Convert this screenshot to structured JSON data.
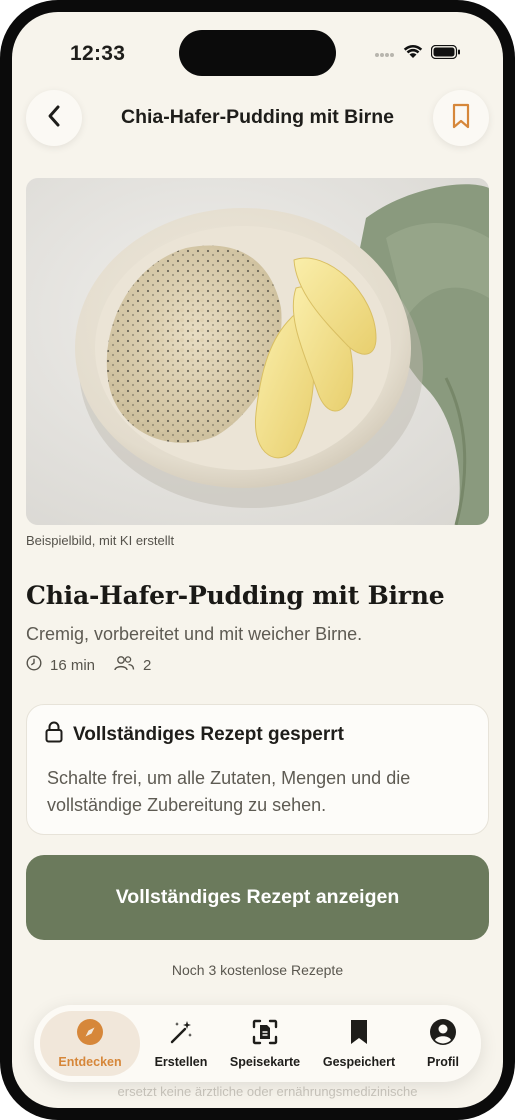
{
  "status_bar": {
    "time": "12:33"
  },
  "header": {
    "title": "Chia-Hafer-Pudding mit Birne"
  },
  "hero": {
    "caption": "Beispielbild, mit KI erstellt"
  },
  "recipe": {
    "title": "Chia-Hafer-Pudding mit Birne",
    "subtitle": "Cremig, vorbereitet und mit weicher Birne.",
    "time": "16 min",
    "servings": "2"
  },
  "locked": {
    "title": "Vollständiges Rezept gesperrt",
    "text": "Schalte frei, um alle Zutaten, Mengen und die vollständige Zubereitung zu sehen."
  },
  "cta": {
    "label": "Vollständiges Rezept anzeigen"
  },
  "free_note": "Noch 3 kostenlose Rezepte",
  "under_text": "ersetzt keine ärztliche oder ernährungsmedizinische",
  "tabs": [
    {
      "label": "Entdecken",
      "icon": "compass-icon",
      "active": true
    },
    {
      "label": "Erstellen",
      "icon": "magic-wand-icon",
      "active": false
    },
    {
      "label": "Speisekarte",
      "icon": "scan-menu-icon",
      "active": false
    },
    {
      "label": "Gespeichert",
      "icon": "bookmark-icon",
      "active": false
    },
    {
      "label": "Profil",
      "icon": "profile-icon",
      "active": false
    }
  ],
  "colors": {
    "background": "#f7f4ec",
    "accent": "#d6873a",
    "cta": "#6b7a5c",
    "text": "#1e1d1a"
  }
}
